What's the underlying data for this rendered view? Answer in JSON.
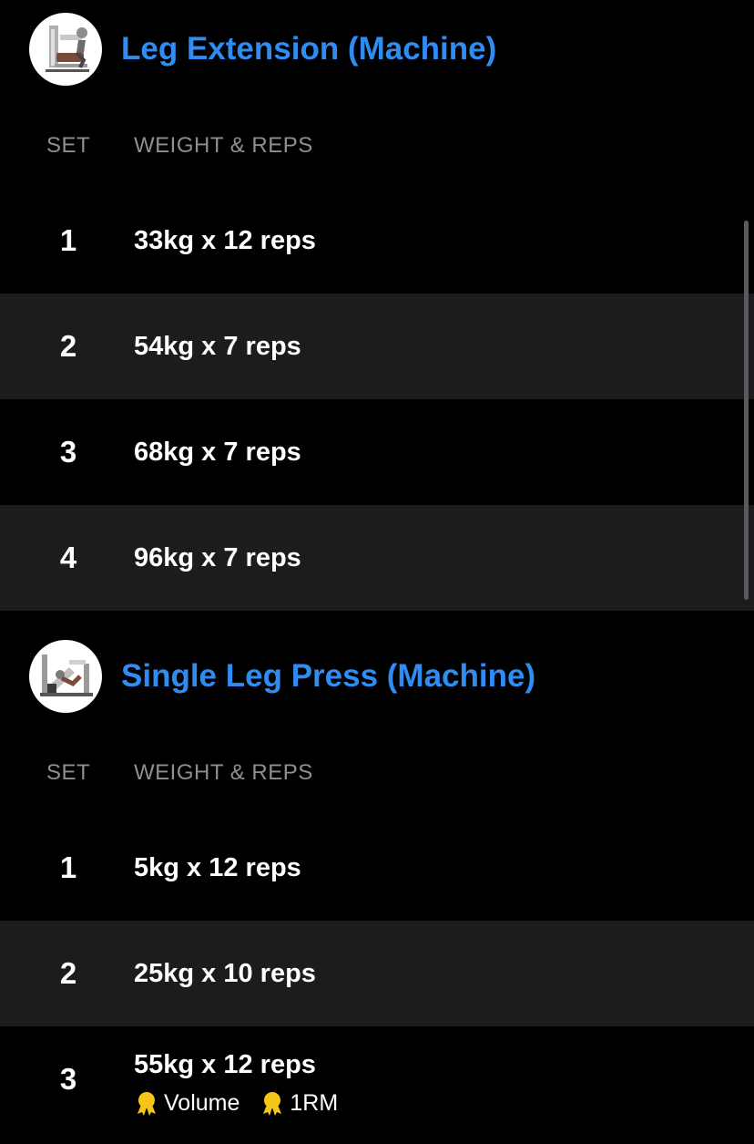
{
  "exercises": [
    {
      "title": "Leg Extension (Machine)",
      "thumbnail_icon": "leg-extension-machine-icon",
      "columns": {
        "set": "SET",
        "weight_reps": "WEIGHT & REPS"
      },
      "sets": [
        {
          "number": "1",
          "value": "33kg x 12 reps"
        },
        {
          "number": "2",
          "value": "54kg x 7 reps"
        },
        {
          "number": "3",
          "value": "68kg x 7 reps"
        },
        {
          "number": "4",
          "value": "96kg x 7 reps"
        }
      ]
    },
    {
      "title": "Single Leg Press (Machine)",
      "thumbnail_icon": "leg-press-machine-icon",
      "columns": {
        "set": "SET",
        "weight_reps": "WEIGHT & REPS"
      },
      "sets": [
        {
          "number": "1",
          "value": "5kg x 12 reps"
        },
        {
          "number": "2",
          "value": "25kg x 10 reps"
        },
        {
          "number": "3",
          "value": "55kg x 12 reps",
          "badges": [
            {
              "icon": "medal-icon",
              "label": "Volume"
            },
            {
              "icon": "medal-icon",
              "label": "1RM"
            }
          ]
        }
      ]
    }
  ],
  "colors": {
    "background": "#000000",
    "row_alternate": "#1c1c1e",
    "accent_blue": "#2f8cf3",
    "header_gray": "#8e8e93",
    "medal_gold": "#f5c518"
  }
}
